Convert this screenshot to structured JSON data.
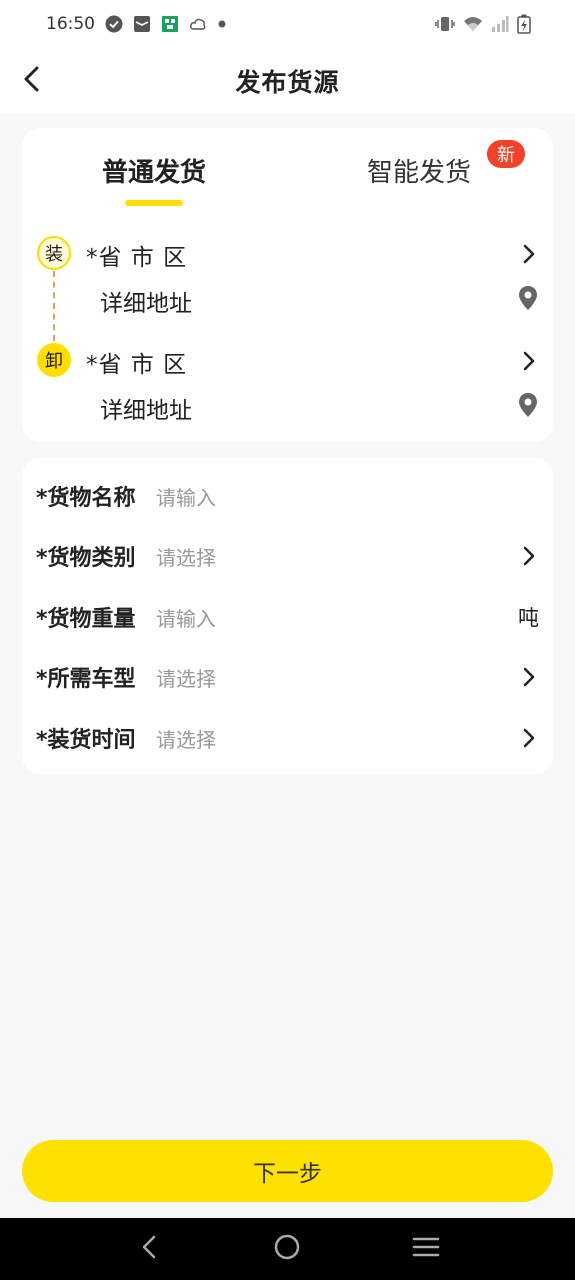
{
  "status_bar": {
    "time": "16:50",
    "icons": [
      "check-circle-icon",
      "mail-icon",
      "app-notification-icon",
      "cloud-icon",
      "dot-icon",
      "vibrate-icon",
      "wifi-icon",
      "signal-icon",
      "battery-charging-icon"
    ]
  },
  "header": {
    "title": "发布货源",
    "back_icon": "chevron-left-icon"
  },
  "tabs": {
    "normal": "普通发货",
    "smart": "智能发货",
    "smart_badge": "新",
    "active": "normal",
    "accent_color": "#ffde00",
    "badge_color": "#f2432a"
  },
  "address": {
    "load": {
      "marker": "装",
      "region_placeholder": "*省 市 区",
      "detail_placeholder": "详细地址"
    },
    "unload": {
      "marker": "卸",
      "region_placeholder": "*省 市 区",
      "detail_placeholder": "详细地址"
    }
  },
  "goods": {
    "rows": [
      {
        "label": "*货物名称",
        "placeholder": "请输入",
        "type": "input"
      },
      {
        "label": "*货物类别",
        "placeholder": "请选择",
        "type": "select"
      },
      {
        "label": "*货物重量",
        "placeholder": "请输入",
        "type": "input",
        "unit": "吨"
      },
      {
        "label": "*所需车型",
        "placeholder": "请选择",
        "type": "select"
      },
      {
        "label": "*装货时间",
        "placeholder": "请选择",
        "type": "select"
      }
    ]
  },
  "next_button": {
    "label": "下一步",
    "color": "#ffe100"
  },
  "nav_bar": {
    "icons": [
      "back-triangle-icon",
      "home-circle-icon",
      "menu-lines-icon"
    ]
  }
}
